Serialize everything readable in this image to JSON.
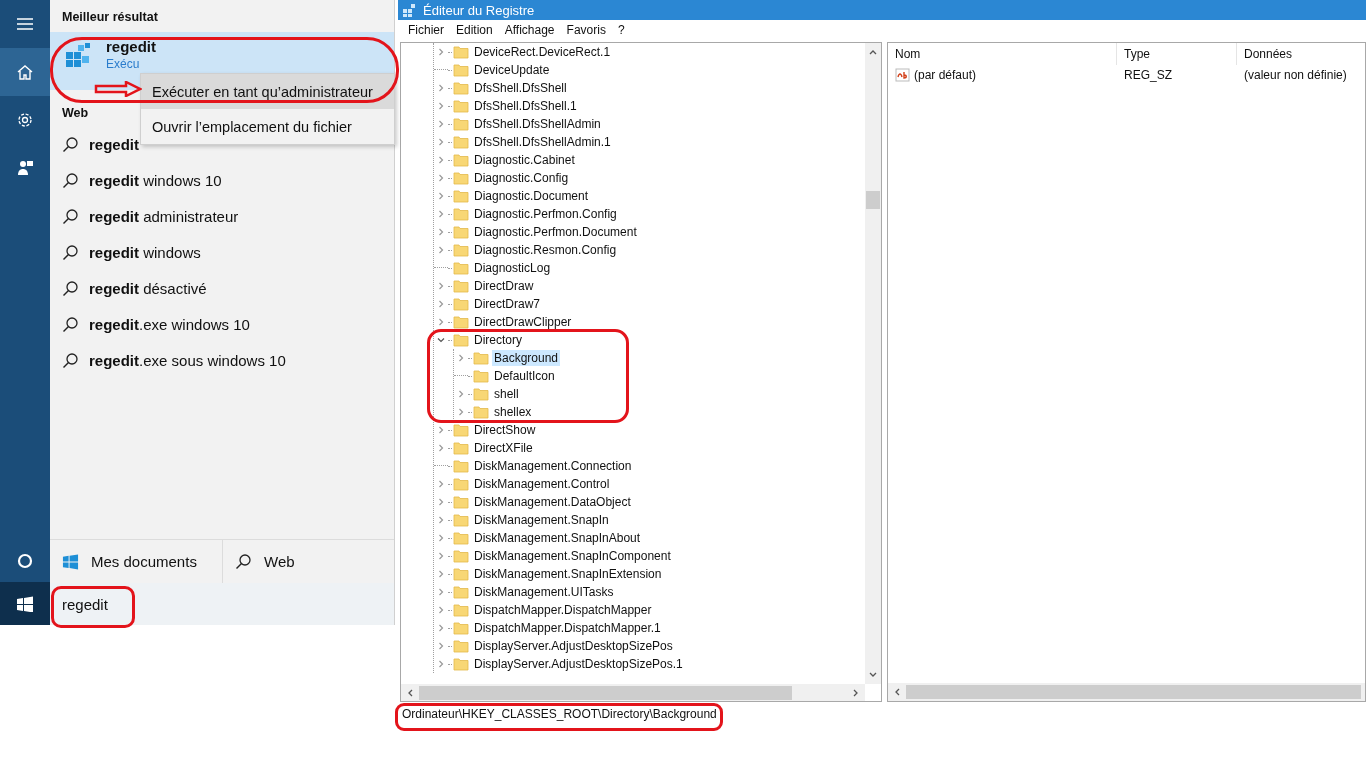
{
  "start_menu": {
    "rail": [
      {
        "kind": "menu",
        "selected": false
      },
      {
        "kind": "home",
        "selected": true
      },
      {
        "kind": "settings",
        "selected": false
      },
      {
        "kind": "feedback",
        "selected": false
      }
    ],
    "rail_bottom": [
      {
        "kind": "cortana",
        "selected": false
      },
      {
        "kind": "start",
        "selected": true
      }
    ],
    "best_match": {
      "heading": "Meilleur résultat",
      "title": "regedit",
      "subtitle": "Exécu"
    },
    "context_menu": [
      {
        "label": "Exécuter en tant qu’administrateur",
        "selected": true
      },
      {
        "label": "Ouvrir l’emplacement du fichier",
        "selected": false
      }
    ],
    "web": {
      "heading": "Web",
      "suggestions": [
        "**regedit**",
        "**regedit** windows 10",
        "**regedit** administrateur",
        "**regedit** windows",
        "**regedit** désactivé",
        "**regedit**.exe windows 10",
        "**regedit**.exe sous windows 10"
      ]
    },
    "scopes": [
      {
        "kind": "documents",
        "label": "Mes documents"
      },
      {
        "kind": "web",
        "label": "Web"
      }
    ],
    "search_box": {
      "value": "regedit"
    }
  },
  "registry_editor": {
    "title": "Éditeur du Registre",
    "menu": [
      "Fichier",
      "Edition",
      "Affichage",
      "Favoris",
      "?"
    ],
    "tree": [
      {
        "name": "DeviceRect.DeviceRect.1",
        "has_children": true,
        "expanded": false,
        "selected": false
      },
      {
        "name": "DeviceUpdate",
        "has_children": false,
        "expanded": false,
        "selected": false
      },
      {
        "name": "DfsShell.DfsShell",
        "has_children": true,
        "expanded": false,
        "selected": false
      },
      {
        "name": "DfsShell.DfsShell.1",
        "has_children": true,
        "expanded": false,
        "selected": false
      },
      {
        "name": "DfsShell.DfsShellAdmin",
        "has_children": true,
        "expanded": false,
        "selected": false
      },
      {
        "name": "DfsShell.DfsShellAdmin.1",
        "has_children": true,
        "expanded": false,
        "selected": false
      },
      {
        "name": "Diagnostic.Cabinet",
        "has_children": true,
        "expanded": false,
        "selected": false
      },
      {
        "name": "Diagnostic.Config",
        "has_children": true,
        "expanded": false,
        "selected": false
      },
      {
        "name": "Diagnostic.Document",
        "has_children": true,
        "expanded": false,
        "selected": false
      },
      {
        "name": "Diagnostic.Perfmon.Config",
        "has_children": true,
        "expanded": false,
        "selected": false
      },
      {
        "name": "Diagnostic.Perfmon.Document",
        "has_children": true,
        "expanded": false,
        "selected": false
      },
      {
        "name": "Diagnostic.Resmon.Config",
        "has_children": true,
        "expanded": false,
        "selected": false
      },
      {
        "name": "DiagnosticLog",
        "has_children": false,
        "expanded": false,
        "selected": false
      },
      {
        "name": "DirectDraw",
        "has_children": true,
        "expanded": false,
        "selected": false
      },
      {
        "name": "DirectDraw7",
        "has_children": true,
        "expanded": false,
        "selected": false
      },
      {
        "name": "DirectDrawClipper",
        "has_children": true,
        "expanded": false,
        "selected": false
      },
      {
        "name": "Directory",
        "has_children": true,
        "expanded": true,
        "selected": false,
        "children": [
          {
            "name": "Background",
            "has_children": true,
            "expanded": false,
            "selected": true
          },
          {
            "name": "DefaultIcon",
            "has_children": false,
            "expanded": false,
            "selected": false
          },
          {
            "name": "shell",
            "has_children": true,
            "expanded": false,
            "selected": false
          },
          {
            "name": "shellex",
            "has_children": true,
            "expanded": false,
            "selected": false
          }
        ]
      },
      {
        "name": "DirectShow",
        "has_children": true,
        "expanded": false,
        "selected": false
      },
      {
        "name": "DirectXFile",
        "has_children": true,
        "expanded": false,
        "selected": false
      },
      {
        "name": "DiskManagement.Connection",
        "has_children": false,
        "expanded": false,
        "selected": false
      },
      {
        "name": "DiskManagement.Control",
        "has_children": true,
        "expanded": false,
        "selected": false
      },
      {
        "name": "DiskManagement.DataObject",
        "has_children": true,
        "expanded": false,
        "selected": false
      },
      {
        "name": "DiskManagement.SnapIn",
        "has_children": true,
        "expanded": false,
        "selected": false
      },
      {
        "name": "DiskManagement.SnapInAbout",
        "has_children": true,
        "expanded": false,
        "selected": false
      },
      {
        "name": "DiskManagement.SnapInComponent",
        "has_children": true,
        "expanded": false,
        "selected": false
      },
      {
        "name": "DiskManagement.SnapInExtension",
        "has_children": true,
        "expanded": false,
        "selected": false
      },
      {
        "name": "DiskManagement.UITasks",
        "has_children": true,
        "expanded": false,
        "selected": false
      },
      {
        "name": "DispatchMapper.DispatchMapper",
        "has_children": true,
        "expanded": false,
        "selected": false
      },
      {
        "name": "DispatchMapper.DispatchMapper.1",
        "has_children": true,
        "expanded": false,
        "selected": false
      },
      {
        "name": "DisplayServer.AdjustDesktopSizePos",
        "has_children": true,
        "expanded": false,
        "selected": false
      },
      {
        "name": "DisplayServer.AdjustDesktopSizePos.1",
        "has_children": true,
        "expanded": false,
        "selected": false
      }
    ],
    "values": {
      "columns": [
        "Nom",
        "Type",
        "Données"
      ],
      "rows": [
        {
          "name": "(par défaut)",
          "type": "REG_SZ",
          "data": "(valeur non définie)"
        }
      ]
    },
    "status_bar": "Ordinateur\\HKEY_CLASSES_ROOT\\Directory\\Background"
  }
}
